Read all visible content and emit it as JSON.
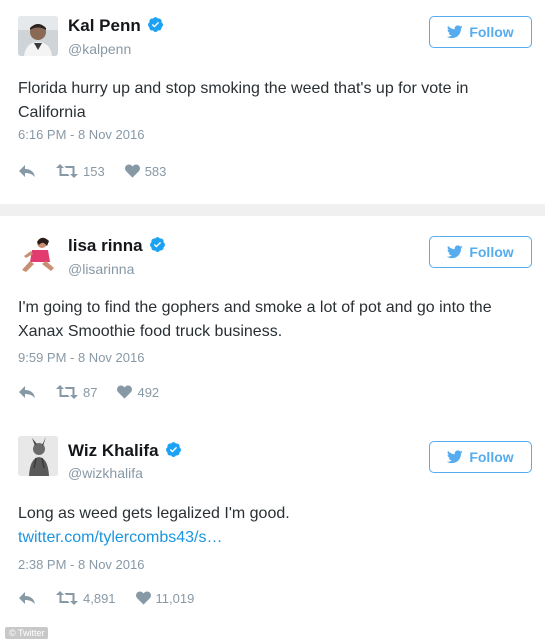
{
  "tweets": [
    {
      "display_name": "Kal Penn",
      "handle": "@kalpenn",
      "follow_label": "Follow",
      "text": "Florida hurry up and stop smoking the weed that's up for vote in California",
      "link": "",
      "timestamp": "6:16 PM - 8 Nov 2016",
      "retweets": "153",
      "likes": "583"
    },
    {
      "display_name": "lisa rinna",
      "handle": "@lisarinna",
      "follow_label": "Follow",
      "text": "I'm going to find the gophers and smoke a lot of pot and go into the Xanax Smoothie food truck business.",
      "link": "",
      "timestamp": "9:59 PM - 8 Nov 2016",
      "retweets": "87",
      "likes": "492"
    },
    {
      "display_name": "Wiz Khalifa",
      "handle": "@wizkhalifa",
      "follow_label": "Follow",
      "text": "Long as weed gets legalized I'm good.",
      "link": "twitter.com/tylercombs43/s…",
      "timestamp": "2:38 PM - 8 Nov 2016",
      "retweets": "4,891",
      "likes": "11,019"
    }
  ],
  "watermark": "© Twitter",
  "colors": {
    "accent": "#55acee",
    "link": "#1b95e0",
    "muted": "#8899a6",
    "text": "#292f33",
    "separator": "#f0f0f0"
  },
  "icons": [
    "verified-icon",
    "twitter-bird-icon",
    "reply-icon",
    "retweet-icon",
    "heart-icon"
  ]
}
